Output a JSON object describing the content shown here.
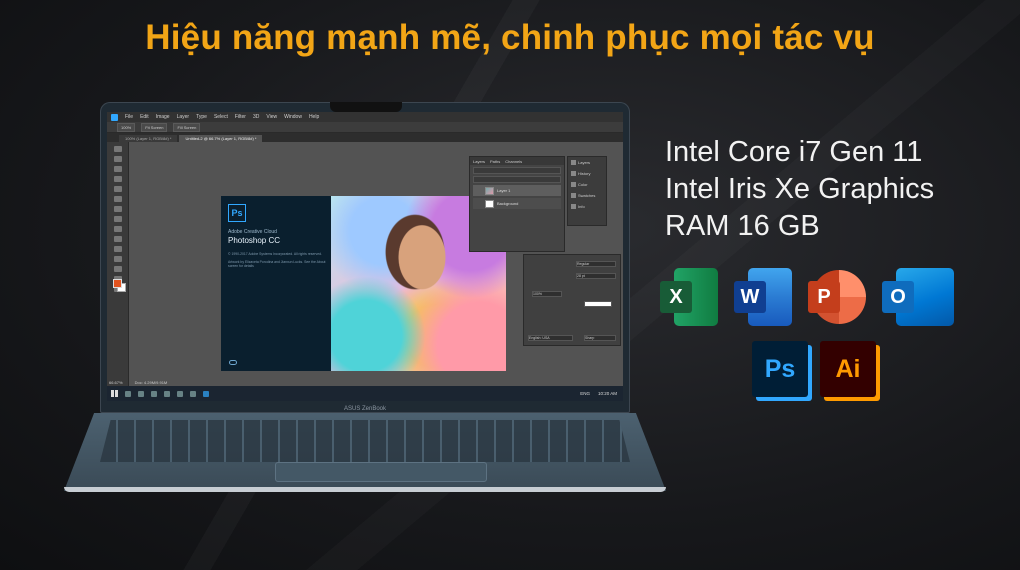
{
  "headline": "Hiệu năng mạnh mẽ, chinh phục mọi tác vụ",
  "colors": {
    "accent": "#f2a516",
    "excel": "#1d7044",
    "word": "#2b579a",
    "powerpoint": "#c43e1c",
    "outlook": "#0f6cbd",
    "photoshop": "#31a8ff",
    "illustrator": "#ff9a00"
  },
  "specs": [
    "Intel Core i7 Gen 11",
    "Intel Iris Xe Graphics",
    "RAM 16 GB"
  ],
  "apps": [
    {
      "name": "Excel",
      "letter": "X",
      "icon": "excel-icon"
    },
    {
      "name": "Word",
      "letter": "W",
      "icon": "word-icon"
    },
    {
      "name": "PowerPoint",
      "letter": "P",
      "icon": "powerpoint-icon"
    },
    {
      "name": "Outlook",
      "letter": "O",
      "icon": "outlook-icon"
    },
    {
      "name": "Photoshop",
      "letter": "Ps",
      "icon": "photoshop-icon"
    },
    {
      "name": "Illustrator",
      "letter": "Ai",
      "icon": "illustrator-icon"
    }
  ],
  "laptop": {
    "brand": "ASUS ZenBook",
    "photoshop": {
      "menu": [
        "File",
        "Edit",
        "Image",
        "Layer",
        "Type",
        "Select",
        "Filter",
        "3D",
        "View",
        "Window",
        "Help"
      ],
      "options": [
        "100%",
        "Fit Screen",
        "Fill Screen"
      ],
      "tabs": [
        "100% (Layer 1, RGB/8#) *",
        "Untitled-2 @ 66.7% (Layer 1, RGB/8#) *"
      ],
      "splash": {
        "badge": "Ps",
        "brand": "Adobe Creative Cloud",
        "product": "Photoshop CC",
        "copyright": "© 1990-2017 Adobe Systems Incorporated. All rights reserved.",
        "artwork": "Artwork by Elizaveta Porodina and Jianxun Lucks. See the About screen for details"
      },
      "layers_tabs": [
        "Layers",
        "Paths",
        "Channels"
      ],
      "layers": [
        "Layer 1",
        "Background"
      ],
      "side_panels": [
        "Layers",
        "History",
        "Color",
        "Swatches",
        "Info"
      ],
      "status": [
        "66.67%",
        "Doc: 4.29M/9.91M"
      ],
      "char_values": [
        "Regular",
        "28 pt",
        "100%",
        "English: USA",
        "Sharp"
      ]
    },
    "taskbar": {
      "language": "ENG",
      "time": "10:20 AM"
    }
  }
}
